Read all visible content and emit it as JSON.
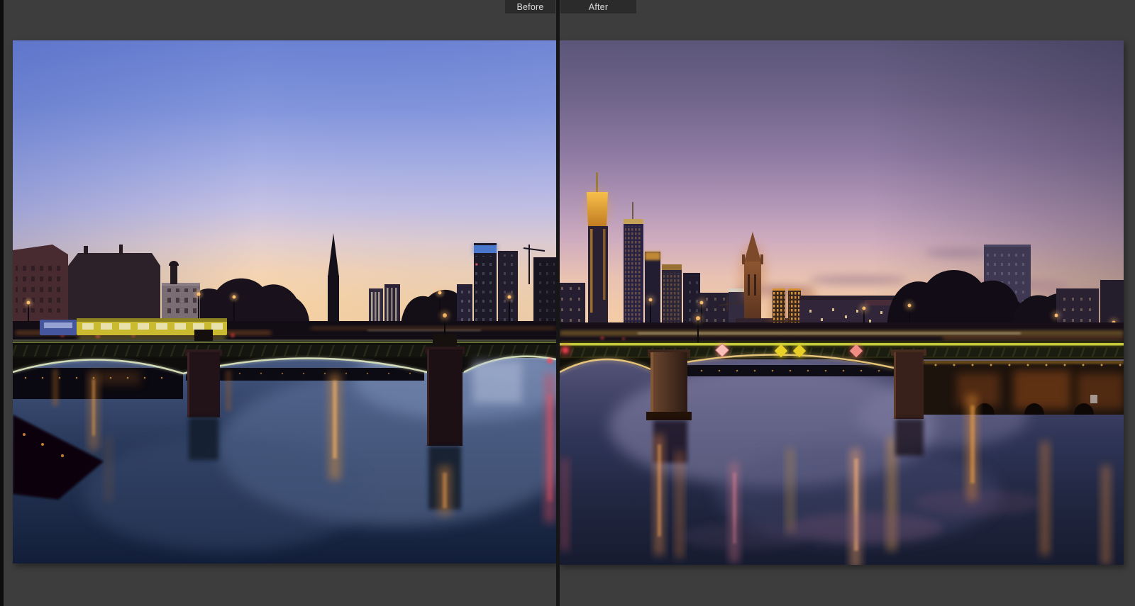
{
  "view": {
    "before_label": "Before",
    "after_label": "After",
    "scene": "Frankfurt skyline and arched bridge over the Main river at dusk, split comparison"
  },
  "chrome": {
    "workspace_background": "#3d3d3d",
    "label_background": "#2b2b2b",
    "label_text_color": "#dcdcdc",
    "divider_color": "#161616",
    "left_edge_strip": "#0d0d0d"
  },
  "photo_palette": {
    "before": {
      "sky_top": "#6b82d3",
      "sky_mid": "#c6c2e4",
      "horizon": "#f8d3a4",
      "water_top": "#4d5e88",
      "water_deep": "#121e38",
      "light_reflections": "#eaa04c",
      "red_light": "#f25868",
      "tram": "#c9ba30"
    },
    "after": {
      "sky_top": "#5b5679",
      "sky_mid": "#b095b6",
      "horizon": "#f3cba6",
      "water_top": "#565478",
      "water_deep": "#161b30",
      "light_reflections": "#f0a050",
      "bridge_rail_light": "#cbd23e",
      "tower_glow": "#f0b040"
    }
  }
}
